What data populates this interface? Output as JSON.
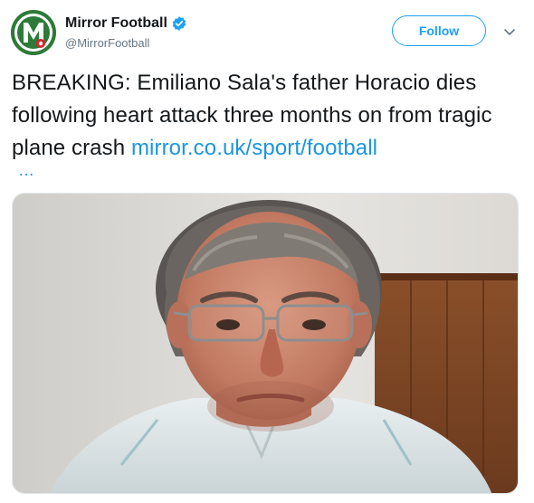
{
  "account": {
    "display_name": "Mirror Football",
    "handle": "@MirrorFootball",
    "avatar_icon": "mirror-football-logo",
    "verified_icon": "verified-badge-icon"
  },
  "actions": {
    "follow_label": "Follow",
    "more_icon": "chevron-down-icon"
  },
  "tweet": {
    "text": "BREAKING: Emiliano Sala's father Horacio dies following heart attack three months on from tragic plane crash ",
    "link_text": "mirror.co.uk/sport/football",
    "ellipsis": "…"
  },
  "media": {
    "type": "photo"
  },
  "colors": {
    "accent": "#1da1f2",
    "link": "#1b95e0",
    "text": "#14171a",
    "secondary": "#657786",
    "brand_green": "#2f7d3a"
  }
}
